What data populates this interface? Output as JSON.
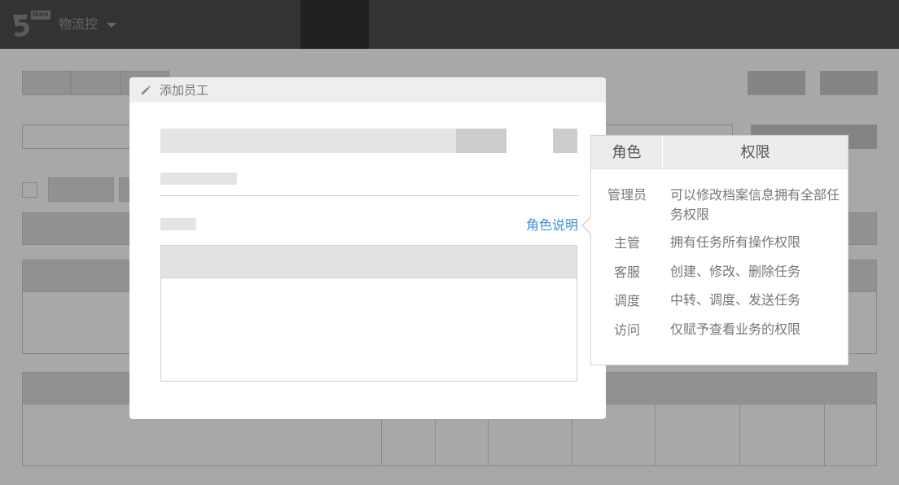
{
  "app": {
    "brand": "物流控",
    "logo_badge": "Ikon",
    "icons": {
      "logo": "logo-icon",
      "caret": "chevron-down-icon",
      "edit": "pencil-icon"
    }
  },
  "dialog": {
    "title": "添加员工",
    "role_help_link": "角色说明"
  },
  "role_popover": {
    "headers": {
      "role": "角色",
      "permission": "权限"
    },
    "rows": [
      {
        "role": "管理员",
        "permission": "可以修改档案信息拥有全部任务权限"
      },
      {
        "role": "主管",
        "permission": "拥有任务所有操作权限"
      },
      {
        "role": "客服",
        "permission": "创建、修改、删除任务"
      },
      {
        "role": "调度",
        "permission": "中转、调度、发送任务"
      },
      {
        "role": "访问",
        "permission": "仅赋予查看业务的权限"
      }
    ]
  },
  "colors": {
    "link": "#3f8fdc",
    "topbar": "#4e4e4e",
    "overlay": "rgba(0,0,0,0.34)"
  }
}
